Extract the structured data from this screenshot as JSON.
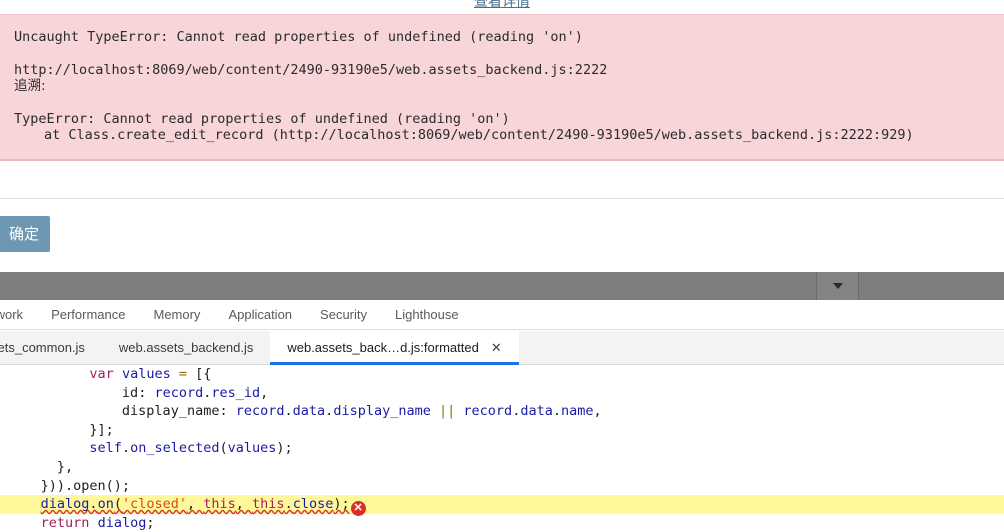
{
  "modal": {
    "detail_link": "查看详情",
    "error": {
      "line1": "Uncaught TypeError: Cannot read properties of undefined (reading 'on')",
      "line2": "http://localhost:8069/web/content/2490-93190e5/web.assets_backend.js:2222",
      "line3": "追溯:",
      "line4": "TypeError: Cannot read properties of undefined (reading 'on')",
      "line5": "at Class.create_edit_record (http://localhost:8069/web/content/2490-93190e5/web.assets_backend.js:2222:929)",
      "background": "#f7d5d8"
    },
    "confirm_label": "确定",
    "confirm_color": "#6e97b2"
  },
  "devtools": {
    "dropdown_icon": "chevron-down-icon",
    "panel_tabs": [
      {
        "label": "twork",
        "active": false
      },
      {
        "label": "Performance",
        "active": false
      },
      {
        "label": "Memory",
        "active": false
      },
      {
        "label": "Application",
        "active": false
      },
      {
        "label": "Security",
        "active": false
      },
      {
        "label": "Lighthouse",
        "active": false
      }
    ],
    "source_tabs": [
      {
        "label": "sets_common.js",
        "active": false,
        "closable": false
      },
      {
        "label": "web.assets_backend.js",
        "active": false,
        "closable": false
      },
      {
        "label": "web.assets_back…d.js:formatted",
        "active": true,
        "closable": true,
        "close_glyph": "✕"
      }
    ],
    "active_tab_underline": "#1a73e8",
    "editor": {
      "highlight_color": "#fff89a",
      "error_marker": "error-circle-icon",
      "error_marker_glyph": "✕",
      "lines": [
        {
          "indent": 11,
          "tokens": [
            {
              "t": "var",
              "c": "kw"
            },
            {
              "t": " ",
              "c": "plain"
            },
            {
              "t": "values",
              "c": "var"
            },
            {
              "t": " ",
              "c": "plain"
            },
            {
              "t": "=",
              "c": "op"
            },
            {
              "t": " ",
              "c": "plain"
            },
            {
              "t": "[{",
              "c": "punc"
            }
          ]
        },
        {
          "indent": 15,
          "tokens": [
            {
              "t": "id",
              "c": "plain"
            },
            {
              "t": ": ",
              "c": "punc"
            },
            {
              "t": "record",
              "c": "var"
            },
            {
              "t": ".",
              "c": "punc"
            },
            {
              "t": "res_id",
              "c": "prop"
            },
            {
              "t": ",",
              "c": "punc"
            }
          ]
        },
        {
          "indent": 15,
          "tokens": [
            {
              "t": "display_name",
              "c": "plain"
            },
            {
              "t": ": ",
              "c": "punc"
            },
            {
              "t": "record",
              "c": "var"
            },
            {
              "t": ".",
              "c": "punc"
            },
            {
              "t": "data",
              "c": "prop"
            },
            {
              "t": ".",
              "c": "punc"
            },
            {
              "t": "display_name",
              "c": "prop"
            },
            {
              "t": " ",
              "c": "plain"
            },
            {
              "t": "||",
              "c": "op"
            },
            {
              "t": " ",
              "c": "plain"
            },
            {
              "t": "record",
              "c": "var"
            },
            {
              "t": ".",
              "c": "punc"
            },
            {
              "t": "data",
              "c": "prop"
            },
            {
              "t": ".",
              "c": "punc"
            },
            {
              "t": "name",
              "c": "prop"
            },
            {
              "t": ",",
              "c": "punc"
            }
          ]
        },
        {
          "indent": 11,
          "tokens": [
            {
              "t": "}];",
              "c": "punc"
            }
          ]
        },
        {
          "indent": 11,
          "tokens": [
            {
              "t": "self",
              "c": "var"
            },
            {
              "t": ".",
              "c": "punc"
            },
            {
              "t": "on_selected",
              "c": "prop"
            },
            {
              "t": "(",
              "c": "punc"
            },
            {
              "t": "values",
              "c": "var"
            },
            {
              "t": ");",
              "c": "punc"
            }
          ]
        },
        {
          "indent": 7,
          "tokens": [
            {
              "t": "},",
              "c": "punc"
            }
          ]
        },
        {
          "indent": 5,
          "tokens": [
            {
              "t": "})).open();",
              "c": "punc"
            }
          ]
        },
        {
          "indent": 5,
          "highlight": true,
          "squiggle": true,
          "marker": true,
          "tokens": [
            {
              "t": "dialog",
              "c": "var"
            },
            {
              "t": ".",
              "c": "punc"
            },
            {
              "t": "on",
              "c": "prop"
            },
            {
              "t": "(",
              "c": "punc"
            },
            {
              "t": "'closed'",
              "c": "str"
            },
            {
              "t": ", ",
              "c": "punc"
            },
            {
              "t": "this",
              "c": "this"
            },
            {
              "t": ", ",
              "c": "punc"
            },
            {
              "t": "this",
              "c": "this"
            },
            {
              "t": ".",
              "c": "punc"
            },
            {
              "t": "close",
              "c": "prop"
            },
            {
              "t": ");",
              "c": "punc"
            }
          ]
        },
        {
          "indent": 5,
          "tokens": [
            {
              "t": "return",
              "c": "kw"
            },
            {
              "t": " ",
              "c": "plain"
            },
            {
              "t": "dialog",
              "c": "var"
            },
            {
              "t": ";",
              "c": "punc"
            }
          ]
        }
      ]
    }
  }
}
